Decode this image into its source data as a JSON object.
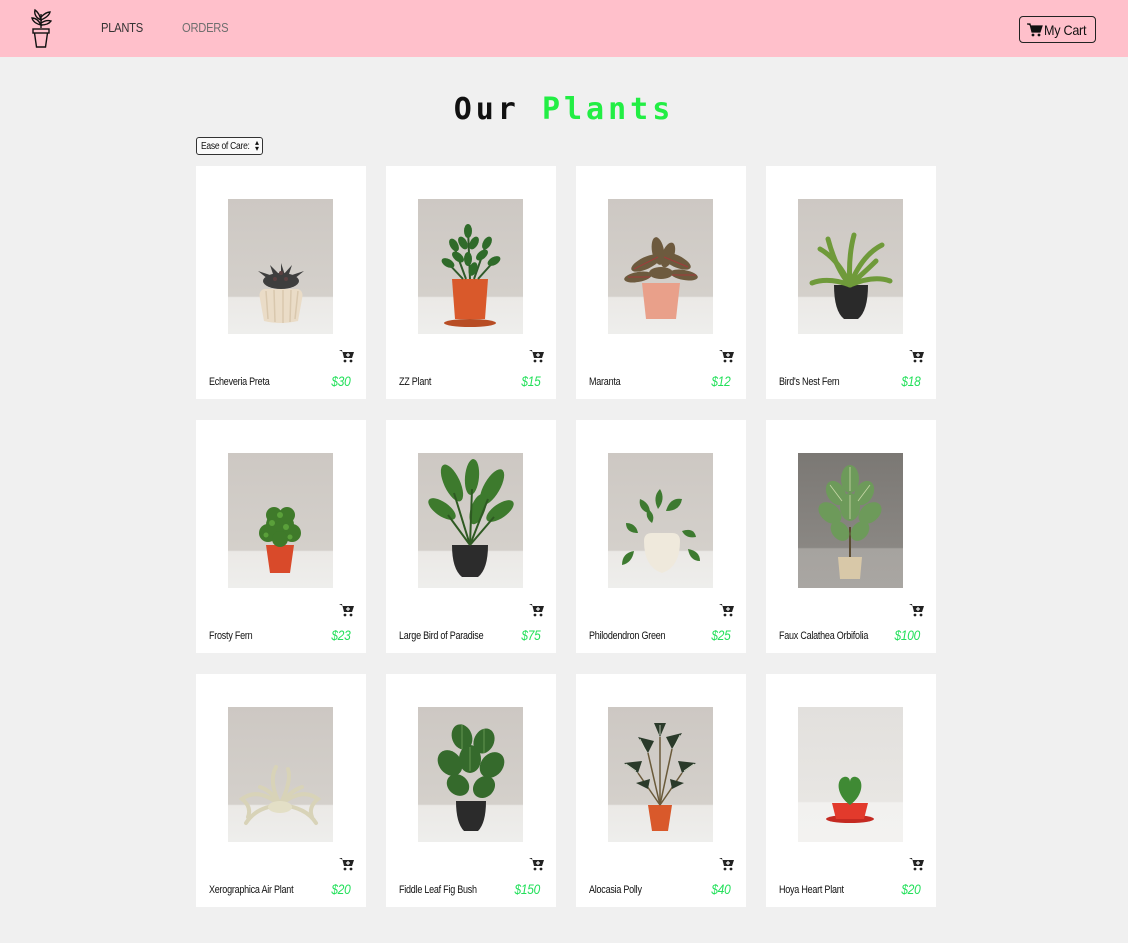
{
  "nav": {
    "logo_icon": "potted-plant-icon",
    "links": [
      "PLANTS",
      "ORDERS"
    ],
    "cart_label": "My Cart",
    "cart_icon": "cart-icon",
    "background": "#ffc0cb"
  },
  "header": {
    "title_part1": "Our",
    "title_part2": "Plants",
    "accent_color": "#22ee44"
  },
  "filter": {
    "selected": "Ease of Care:"
  },
  "products": [
    {
      "name": "Echeveria Preta",
      "price": "$30"
    },
    {
      "name": "ZZ Plant",
      "price": "$15"
    },
    {
      "name": "Maranta",
      "price": "$12"
    },
    {
      "name": "Bird's Nest Fern",
      "price": "$18"
    },
    {
      "name": "Frosty Fern",
      "price": "$23"
    },
    {
      "name": "Large Bird of Paradise",
      "price": "$75"
    },
    {
      "name": "Philodendron Green",
      "price": "$25"
    },
    {
      "name": "Faux Calathea Orbifolia",
      "price": "$100"
    },
    {
      "name": "Xerographica Air Plant",
      "price": "$20"
    },
    {
      "name": "Fiddle Leaf Fig Bush",
      "price": "$150"
    },
    {
      "name": "Alocasia Polly",
      "price": "$40"
    },
    {
      "name": "Hoya Heart Plant",
      "price": "$20"
    }
  ]
}
